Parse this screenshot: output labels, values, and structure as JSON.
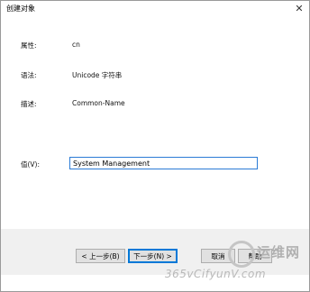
{
  "window": {
    "title": "创建对象",
    "close_glyph": "✕"
  },
  "fields": {
    "attribute_label": "属性:",
    "attribute_value": "cn",
    "syntax_label": "语法:",
    "syntax_value": "Unicode 字符串",
    "description_label": "描述:",
    "description_value": "Common-Name",
    "value_label": "值(V):",
    "value_input": "System Management"
  },
  "buttons": {
    "prev": "< 上一步(B)",
    "next": "下一步(N) >",
    "cancel": "取消",
    "help": "帮助"
  },
  "watermark": {
    "brand_cn": "运维网",
    "url": "365vCifyunV.com"
  }
}
